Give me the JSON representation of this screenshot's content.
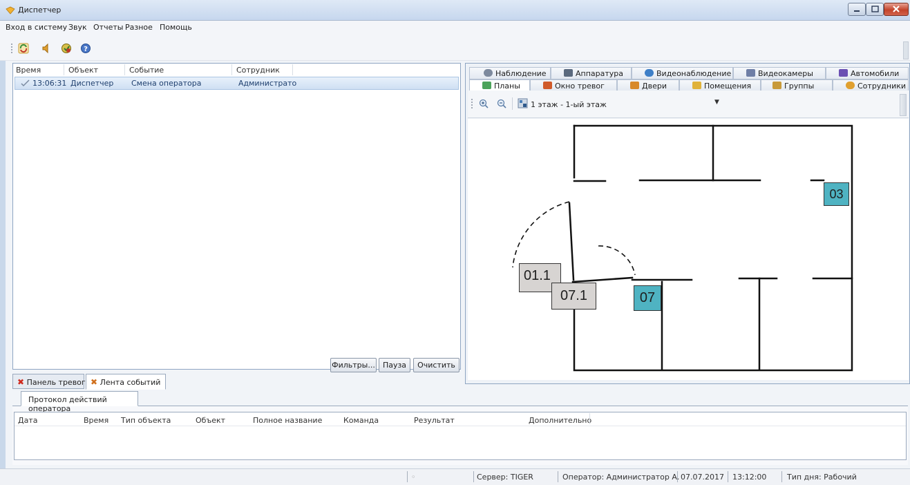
{
  "window": {
    "title": "Диспетчер"
  },
  "menu": [
    "Вход в систему",
    "Звук",
    "Отчеты",
    "Разное",
    "Помощь"
  ],
  "toolbar": {
    "icons": [
      "refresh-icon",
      "sound-icon",
      "reports-icon",
      "help-icon"
    ]
  },
  "events": {
    "columns": [
      "Время",
      "Объект",
      "Событие",
      "Сотрудник"
    ],
    "rows": [
      {
        "time": "13:06:31",
        "object": "Диспетчер",
        "event": "Смена оператора",
        "employee": "Администрато"
      }
    ],
    "buttons": {
      "filters": "Фильтры...",
      "pause": "Пауза",
      "clear": "Очистить"
    }
  },
  "lower_tabs": {
    "alarms": "Панель тревог",
    "feed": "Лента событий"
  },
  "protocol": {
    "tab": "Протокол действий оператора",
    "columns": [
      "Дата",
      "Время",
      "Тип объекта",
      "Объект",
      "Полное название",
      "Команда",
      "Результат",
      "Дополнительно"
    ]
  },
  "right_tabs": {
    "row1": [
      "Наблюдение",
      "Аппаратура",
      "Видеонаблюдение",
      "Видеокамеры",
      "Автомобили"
    ],
    "row2": [
      "Планы",
      "Окно тревог",
      "Двери",
      "Помещения",
      "Группы",
      "Сотрудники"
    ]
  },
  "plan": {
    "floor": "1 этаж - 1-ый этаж",
    "labels": {
      "l03": "03",
      "l011": "01.1",
      "l071": "07.1",
      "l07": "07"
    },
    "colors": {
      "teal": "#4fb3c2",
      "gray": "#d7d4d2"
    }
  },
  "status": {
    "dot": "◦",
    "server": "Сервер: TIGER",
    "operator": "Оператор:  Администратор А.",
    "date": "07.07.2017",
    "time": "13:12:00",
    "daytype": "Тип дня:  Рабочий"
  }
}
